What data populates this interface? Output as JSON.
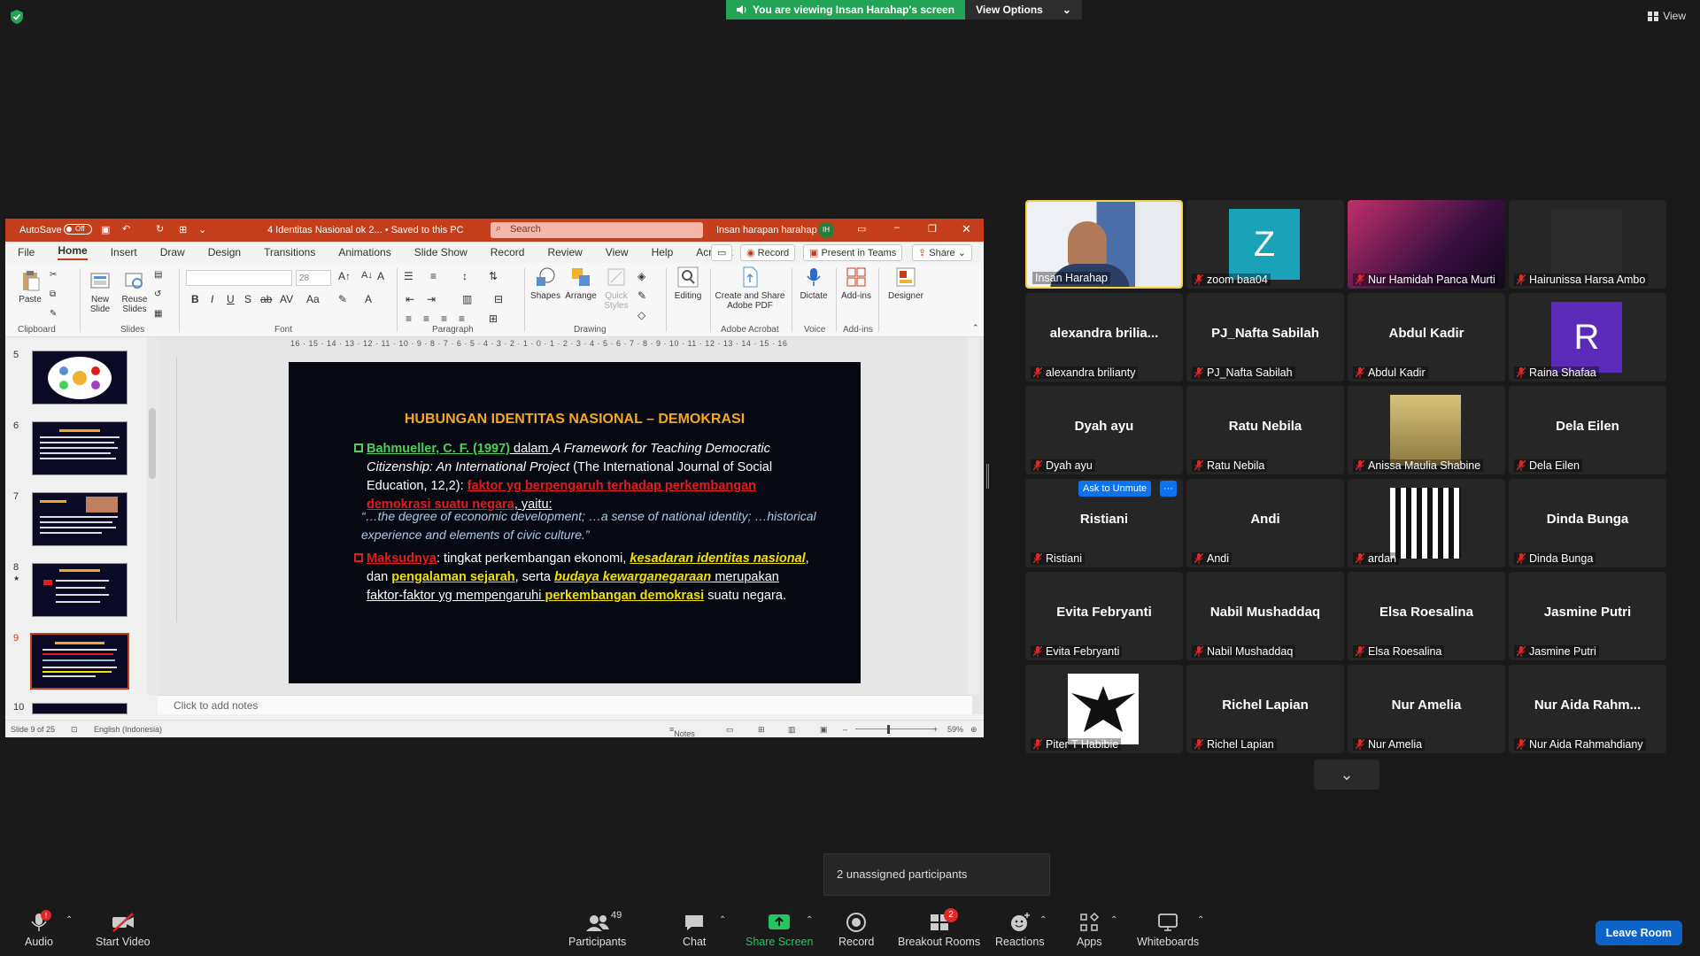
{
  "zoom": {
    "banner_text": "You are viewing Insan Harahap's screen",
    "view_options": "View Options",
    "view_label": "View",
    "toast": "2 unassigned participants",
    "ask_to_unmute": "Ask to Unmute",
    "more": "···",
    "bottom": {
      "audio": "Audio",
      "audio_badge": "!",
      "start_video": "Start Video",
      "participants": "Participants",
      "participants_count": "49",
      "chat": "Chat",
      "share_screen": "Share Screen",
      "record": "Record",
      "breakout_rooms": "Breakout Rooms",
      "breakout_badge": "2",
      "reactions": "Reactions",
      "apps": "Apps",
      "whiteboards": "Whiteboards",
      "leave_room": "Leave Room"
    }
  },
  "participants": [
    {
      "name": "Insan Harahap",
      "display": "",
      "kind": "video"
    },
    {
      "name": "zoom baa04",
      "display": "Z",
      "kind": "avatar",
      "color": "#1aa2b8"
    },
    {
      "name": "Nur Hamidah Panca Murti",
      "display": "",
      "kind": "photo"
    },
    {
      "name": "Hairunissa Harsa Ambo",
      "display": "",
      "kind": "photo"
    },
    {
      "name": "alexandra brilianty",
      "display": "alexandra  brilia...",
      "kind": "text"
    },
    {
      "name": "PJ_Nafta Sabilah",
      "display": "PJ_Nafta Sabilah",
      "kind": "text"
    },
    {
      "name": "Abdul Kadir",
      "display": "Abdul Kadir",
      "kind": "text"
    },
    {
      "name": "Raina Shafaa",
      "display": "R",
      "kind": "avatar",
      "color": "#5a2bb8"
    },
    {
      "name": "Dyah ayu",
      "display": "Dyah ayu",
      "kind": "text"
    },
    {
      "name": "Ratu Nebila",
      "display": "Ratu Nebila",
      "kind": "text"
    },
    {
      "name": "Anissa Maulia Shabine",
      "display": "",
      "kind": "photo"
    },
    {
      "name": "Dela Eilen",
      "display": "Dela Eilen",
      "kind": "text"
    },
    {
      "name": "Ristiani",
      "display": "Ristiani",
      "kind": "text"
    },
    {
      "name": "Andi",
      "display": "Andi",
      "kind": "text"
    },
    {
      "name": "ardan",
      "display": "",
      "kind": "photo"
    },
    {
      "name": "Dinda Bunga",
      "display": "Dinda Bunga",
      "kind": "text"
    },
    {
      "name": "Evita Febryanti",
      "display": "Evita Febryanti",
      "kind": "text"
    },
    {
      "name": "Nabil Mushaddaq",
      "display": "Nabil Mushaddaq",
      "kind": "text"
    },
    {
      "name": "Elsa Roesalina",
      "display": "Elsa Roesalina",
      "kind": "text"
    },
    {
      "name": "Jasmine Putri",
      "display": "Jasmine Putri",
      "kind": "text"
    },
    {
      "name": "Piter T Habibie",
      "display": "",
      "kind": "photo"
    },
    {
      "name": "Richel Lapian",
      "display": "Richel Lapian",
      "kind": "text"
    },
    {
      "name": "Nur Amelia",
      "display": "Nur Amelia",
      "kind": "text"
    },
    {
      "name": "Nur Aida Rahmahdiany",
      "display": "Nur Aida Rahm...",
      "kind": "text"
    }
  ],
  "ppt": {
    "autosave": "AutoSave",
    "autosave_state": "Off",
    "file_title": "4 Identitas Nasional ok 2... • Saved to this PC",
    "search": "Search",
    "user": "Insan harapan harahap",
    "user_initials": "IH",
    "tabs": [
      "File",
      "Home",
      "Insert",
      "Draw",
      "Design",
      "Transitions",
      "Animations",
      "Slide Show",
      "Record",
      "Review",
      "View",
      "Help",
      "Acrobat"
    ],
    "record_btn": "Record",
    "present_teams": "Present in Teams",
    "share": "Share",
    "ribbon": {
      "paste": "Paste",
      "new_slide": "New Slide",
      "reuse_slides": "Reuse Slides",
      "font_size": "28",
      "shapes": "Shapes",
      "arrange": "Arrange",
      "quick_styles": "Quick Styles",
      "editing": "Editing",
      "create_share": "Create and Share Adobe PDF",
      "dictate": "Dictate",
      "addins": "Add-ins",
      "designer": "Designer",
      "groups": {
        "clipboard": "Clipboard",
        "slides": "Slides",
        "font": "Font",
        "paragraph": "Paragraph",
        "drawing": "Drawing",
        "adobe": "Adobe Acrobat",
        "voice": "Voice",
        "addins": "Add-ins"
      }
    },
    "slide_numbers": [
      "5",
      "6",
      "7",
      "8",
      "9",
      "10"
    ],
    "ruler": "16 · 15 · 14 · 13 · 12 · 11 · 10 · 9 · 8 · 7 · 6 · 5 · 4 · 3 · 2 · 1 · 0 · 1 · 2 · 3 · 4 · 5 · 6 · 7 · 8 · 9 · 10 · 11 · 12 · 13 · 14 · 15 · 16",
    "slide": {
      "title": "HUBUNGAN  IDENTITAS  NASIONAL – DEMOKRASI",
      "p1_author": "Bahmueller, C. F. (1997)",
      "p1_dalam": " dalam ",
      "p1_work": "A Framework  for Teaching Democratic Citizenship: An International Project",
      "p1_journal": "  (The International Journal of Social Education, 12,2): ",
      "p1_red": "faktor yg berpengaruh terhadap perkembangan demokrasi suatu negara",
      "p1_end": ", yaitu:",
      "quote": "“…the degree of economic development; …a sense of national identity; …historical experience and elements of civic culture.”",
      "p2_label": "Maksudnya",
      "p2_a": ": tingkat perkembangan ekonomi, ",
      "p2_b": "kesadaran identitas nasional",
      "p2_c": ", dan ",
      "p2_d": "pengalaman sejarah",
      "p2_e": ", serta ",
      "p2_f": "budaya kewarganegaraan",
      "p2_g": " merupakan faktor-faktor yg mempengaruhi ",
      "p2_h": "perkembangan demokrasi",
      "p2_i": " suatu negara."
    },
    "notes_placeholder": "Click to add notes",
    "status": {
      "slide_of": "Slide 9 of 25",
      "language": "English (Indonesia)",
      "notes": "Notes",
      "zoom": "59%"
    }
  }
}
